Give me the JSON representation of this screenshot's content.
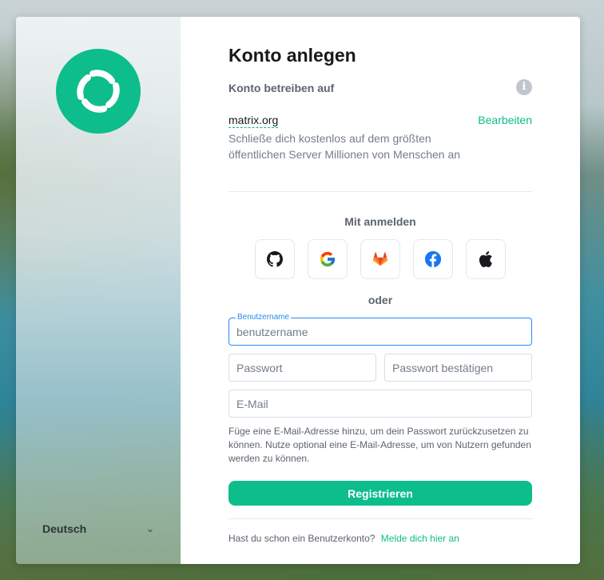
{
  "sidebar": {
    "logo_icon": "element-logo-icon",
    "language": "Deutsch"
  },
  "form": {
    "title": "Konto anlegen",
    "host_label": "Konto betreiben auf",
    "info_icon": "info-icon",
    "server_name": "matrix.org",
    "edit_label": "Bearbeiten",
    "server_description": "Schließe dich kostenlos auf dem größten öffentlichen Server Millionen von Menschen an",
    "sso_label": "Mit anmelden",
    "sso_providers": [
      "github-icon",
      "google-icon",
      "gitlab-icon",
      "facebook-icon",
      "apple-icon"
    ],
    "or_label": "oder",
    "username": {
      "label": "Benutzername",
      "value": "",
      "placeholder": "benutzername"
    },
    "password": {
      "value": "",
      "placeholder": "Passwort"
    },
    "password_confirm": {
      "value": "",
      "placeholder": "Passwort bestätigen"
    },
    "email": {
      "value": "",
      "placeholder": "E-Mail"
    },
    "email_hint": "Füge eine E-Mail-Adresse hinzu, um dein Passwort zurückzusetzen zu können. Nutze optional eine E-Mail-Adresse, um von Nutzern gefunden werden zu können.",
    "register_label": "Registrieren",
    "login_prompt": "Hast du schon ein Benutzerkonto?",
    "login_link": "Melde dich hier an"
  },
  "colors": {
    "accent": "#0dbd8b",
    "focus": "#238cf5",
    "text_primary": "#17191c",
    "text_secondary": "#5c6470"
  }
}
